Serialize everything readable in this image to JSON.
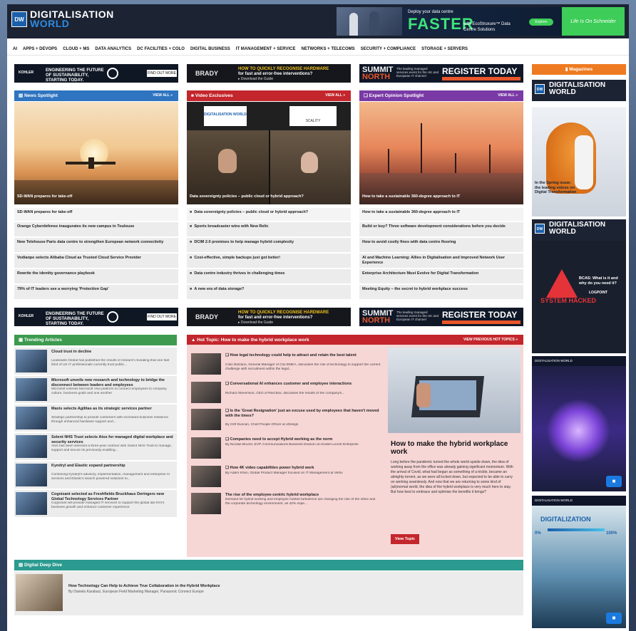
{
  "site": {
    "logo_badge": "DW",
    "logo_line1": "DIGITALISATION",
    "logo_line2": "WORLD"
  },
  "header_ad": {
    "line1": "Deploy your data centre",
    "big": "FASTER",
    "line2": "with EcoStruxure™ Data Centre Solutions",
    "cta": "Explore",
    "brand": "Life Is On Schneider"
  },
  "nav": [
    "AI",
    "APPS + DEVOPS",
    "CLOUD + MS",
    "DATA ANALYTICS",
    "DC FACILITIES + COLO",
    "DIGITAL BUSINESS",
    "IT MANAGEMENT + SERVICE",
    "NETWORKS + TELECOMS",
    "SECURITY + COMPLIANCE",
    "STORAGE + SERVERS"
  ],
  "ads": {
    "kohler": {
      "brand": "KOHLER",
      "text": "ENGINEERING THE FUTURE OF SUSTAINABILITY, STARTING TODAY.",
      "cta": "FIND OUT MORE"
    },
    "brady": {
      "brand": "BRADY",
      "line1": "HOW TO QUICKLY RECOGNISE HARDWARE",
      "line2": "for fast and error-free interventions?",
      "download": "▸ Download the Guide"
    },
    "summit": {
      "word1": "SUMMIT",
      "word2": "NORTH",
      "info": "The leading managed services event for the UK and European IT channel",
      "cta": "REGISTER TODAY"
    }
  },
  "sections": {
    "news": {
      "title": "News Spotlight",
      "view_all": "VIEW ALL »",
      "hero_caption": "SD-WAN prepares for take-off",
      "items": [
        "SD-WAN prepares for take-off",
        "Orange Cyberdefense inaugurates its new campus in Toulouse",
        "New Telehouse Paris data centre to strengthen European network connectivity",
        "Vodianpe selects Alibaba Cloud as Trusted Cloud Service Provider",
        "Rewrite the identity governance playbook",
        "79% of IT leaders see a worrying 'Protection Gap'"
      ]
    },
    "video": {
      "title": "Video Exclusives",
      "view_all": "VIEW ALL »",
      "hero_caption": "Data sovereignty policies – public cloud or hybrid approach?",
      "logo_left": "DIGITALISATION WORLD",
      "logo_right": "SCALITY",
      "items": [
        "Data sovereignty policies – public cloud or hybrid approach?",
        "Sports broadcaster wins with New Relic",
        "DCIM 2.0 promises to help manage hybrid complexity",
        "Cost-effective, simple backups just got better!",
        "Data centre industry thrives in challenging times",
        "A new era of data storage?"
      ]
    },
    "expert": {
      "title": "Expert Opinion Spotlight",
      "view_all": "VIEW ALL »",
      "hero_caption": "How to take a sustainable 360-degree approach to IT",
      "items": [
        "How to take a sustainable 360-degree approach to IT",
        "Build or buy? Three software development considerations before you decide",
        "How to avoid costly fines with data centre flooring",
        "AI and Machine Learning: Allies in Digitalisation and Improved Network User Experience",
        "Enterprise Architecture Must Evolve for Digital Transformation",
        "Meeting Equity – the secret to hybrid workplace success"
      ]
    },
    "magazines": {
      "title": "Magazines",
      "m1_caption": "In the Spring issue: the leading voices on Digital Transformation",
      "m2_caption": "BCAS: What is it and why do you need it?",
      "m2_sub": "SYSTEM HACKED",
      "m2_brand": "LOGPOINT",
      "m3_brand": "DIGITALISATION WORLD",
      "m4_brand": "DIGITALISATION WORLD",
      "m4_title": "DIGITALIZATION",
      "m4_left": "0%",
      "m4_right": "100%"
    },
    "trending": {
      "title": "Trending Articles",
      "items": [
        {
          "title": "Cloud trust in decline",
          "desc": "Leaseweb Global has published the results of research revealing that one fast third of UK IT professionals currently trust public..."
        },
        {
          "title": "Microsoft unveils new research and technology to bridge the disconnect between leaders and employees",
          "desc": "Microsoft extends Microsoft Viva platform to connect employees to company culture, business goals and one another"
        },
        {
          "title": "Maxis selects Agilitas as its strategic services partner",
          "desc": "Strategic partnership to provide customers with increased business resilience through enhanced hardware support and..."
        },
        {
          "title": "Solent NHS Trust selects Atos for managed digital workplace and security services",
          "desc": "Atos has been selected a three-year contract with Solent NHS Trust to manage, support and secure its previously enabling..."
        },
        {
          "title": "Kyndryl and Elastic expand partnership",
          "desc": "Combining Kyndryl's advisory, implementation, management and enterprise AI services and Elastic's search powered solutions to..."
        },
        {
          "title": "Cognizant selected as Freshfields Bruckhaus Deringers new Global Technology Services Partner",
          "desc": "Cognizant will provide managed IT services to support the global law firm's business growth and enhance customer experience"
        }
      ]
    },
    "hot": {
      "title": "Hot Topic: How to make the hybrid workplace work",
      "view_prev": "VIEW PREVIOUS HOT TOPICS »",
      "items": [
        {
          "title": "How legal technology could help to attract and retain the best talent",
          "desc": "Colin Bolzano, General Manager of Clio EMEA, discusses the role of technology to support the current challenge with recruitment within the legal..."
        },
        {
          "title": "Conversational AI enhances customer and employee interactions",
          "desc": "Richard Stevenson, CEO of Red Box, discusses the results of the company's..."
        },
        {
          "title": "Is the 'Great Resignation' just an excuse used by employees that haven't moved with the times?",
          "desc": "By Cliff Duncan, Chief People Officer at xDesign"
        },
        {
          "title": "Companies need to accept Hybrid working as the norm",
          "desc": "By Nicolas Brunel, EVP, Communications Business Division at Alcatel-Lucent Enterprise"
        },
        {
          "title": "How 4K video capabilities power hybrid work",
          "desc": "By Adam Khan, Global Product Manager focused on IT Management at Vertiv"
        },
        {
          "title": "The rise of the employee-centric hybrid workplace",
          "desc": "Demand for hybrid working and employee market turbulence are changing the role of the office and the corporate technology environment, as 42% expe..."
        }
      ],
      "feature_title": "How to make the hybrid workplace work",
      "feature_desc": "Long before the pandemic turned the whole world upside down, the idea of working away from the office was already gaining significant momentum. With the arrival of Covid, what had begun as something of a trickle, became an almighty torrent, as we were all locked down, but expected to be able to carry on working seamlessly. And now that we are returning to some kind of (ab)normal world, the idea of the hybrid workplace is very much here to stay. But how best to embrace and optimise the benefits it brings?",
      "feature_button": "View Topic"
    },
    "deep": {
      "title": "Digital Deep Dive",
      "item_title": "How Technology Can Help to Achieve True Collaboration in the Hybrid Workplace",
      "item_desc": "By Daniela Karabaci, European Field Marketing Manager, Panasonic Connect Europe"
    }
  }
}
